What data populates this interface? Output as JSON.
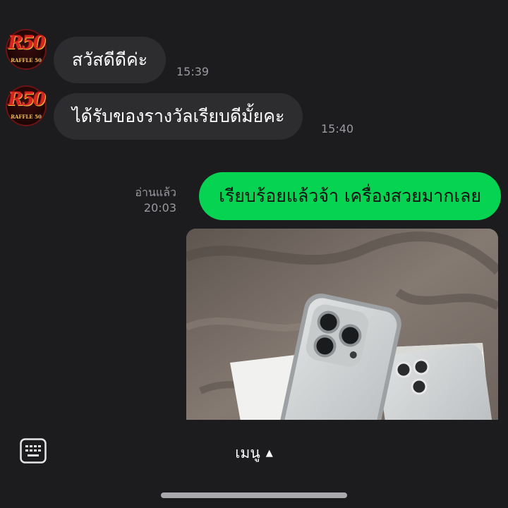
{
  "contact": {
    "avatar_text": "R50",
    "avatar_subtext": "RAFFLE 50"
  },
  "messages": [
    {
      "direction": "in",
      "text": "สวัสดีดีค่ะ",
      "time": "15:39"
    },
    {
      "direction": "in",
      "text": "ได้รับของรางวัลเรียบดีมั้ยคะ",
      "time": "15:40"
    },
    {
      "direction": "out",
      "text": "เรียบร้อยแล้วจ้า เครื่องสวยมากเลย",
      "read_label": "อ่านแล้ว",
      "time": "20:03"
    },
    {
      "direction": "out",
      "type": "image",
      "alt_subject": "phone-photo"
    }
  ],
  "bottom_bar": {
    "keyboard_icon": "keyboard-icon",
    "menu_label": "เมนู",
    "menu_caret": "▲"
  },
  "colors": {
    "background": "#1c1c1e",
    "incoming_bubble": "#2d2d30",
    "outgoing_bubble": "#06d352",
    "timestamp": "#9a9aa0"
  }
}
